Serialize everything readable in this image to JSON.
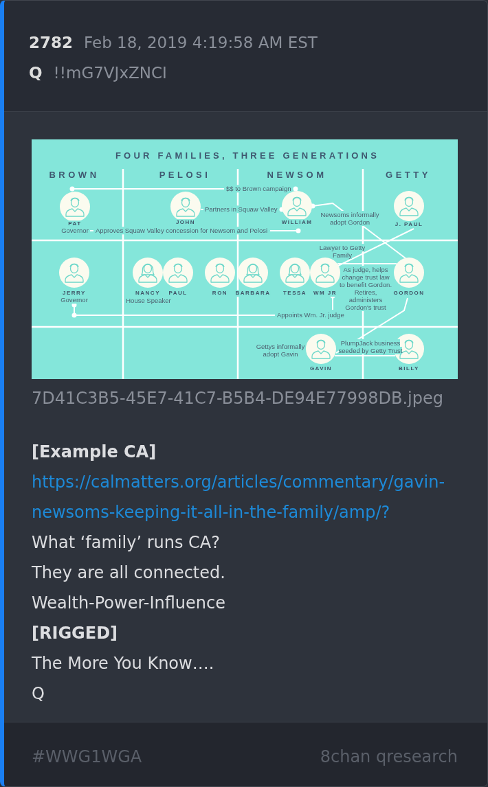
{
  "post": {
    "number": "2782",
    "timestamp": "Feb 18, 2019 4:19:58 AM EST",
    "author": "Q",
    "tripcode": "!!mG7VJxZNCI"
  },
  "attachment": {
    "infographic": {
      "title": "FOUR FAMILIES, THREE GENERATIONS",
      "families": [
        "BROWN",
        "PELOSI",
        "NEWSOM",
        "GETTY"
      ],
      "people": [
        {
          "name": "PAT",
          "role": "Governor"
        },
        {
          "name": "JOHN"
        },
        {
          "name": "WILLIAM"
        },
        {
          "name": "J. PAUL"
        },
        {
          "name": "JERRY",
          "role": "Governor"
        },
        {
          "name": "NANCY",
          "role": "House Speaker"
        },
        {
          "name": "PAUL"
        },
        {
          "name": "RON"
        },
        {
          "name": "BARBARA"
        },
        {
          "name": "TESSA"
        },
        {
          "name": "WM JR"
        },
        {
          "name": "GORDON"
        },
        {
          "name": "GAVIN"
        },
        {
          "name": "BILLY"
        }
      ],
      "connections": [
        {
          "label": "$$ to Brown campaign"
        },
        {
          "label": "Partners in Squaw Valley"
        },
        {
          "label": "Approves Squaw Valley concession for Newsom and Pelosi"
        },
        {
          "label": "Newsoms informally adopt Gordon"
        },
        {
          "label": "Lawyer to Getty Family"
        },
        {
          "label": "As judge, helps change trust law to benefit Gordon. Retires, administers Gordon's trust"
        },
        {
          "label": "Appoints Wm. Jr. judge"
        },
        {
          "label": "Gettys informally adopt Gavin"
        },
        {
          "label": "PlumpJack business seeded by Getty Trust"
        }
      ]
    },
    "filename": "7D41C3B5-45E7-41C7-B5B4-DE94E77998DB.jpeg"
  },
  "message": [
    {
      "kind": "bold",
      "text": "[Example CA]"
    },
    {
      "kind": "link",
      "text": "https://calmatters.org/articles/commentary/gavin-newsoms-keeping-it-all-in-the-family/amp/?"
    },
    {
      "kind": "plain",
      "text": "What ‘family’ runs CA?"
    },
    {
      "kind": "plain",
      "text": "They are all connected."
    },
    {
      "kind": "plain",
      "text": "Wealth-Power-Influence"
    },
    {
      "kind": "bold",
      "text": "[RIGGED]"
    },
    {
      "kind": "plain",
      "text": "The More You Know…."
    },
    {
      "kind": "plain",
      "text": "Q"
    }
  ],
  "footer": {
    "tag": "#WWG1WGA",
    "source": "8chan qresearch"
  }
}
